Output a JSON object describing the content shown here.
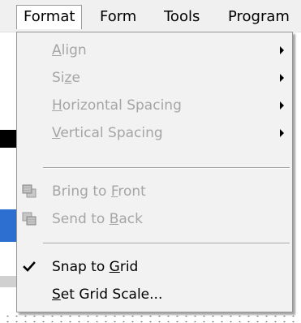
{
  "menubar": {
    "items": [
      {
        "label": "Format",
        "active": true
      },
      {
        "label": "Form"
      },
      {
        "label": "Tools"
      },
      {
        "label": "Program"
      }
    ]
  },
  "format_menu": {
    "items": [
      {
        "pre": "",
        "key": "A",
        "post": "lign",
        "enabled": false,
        "submenu": true,
        "icon": ""
      },
      {
        "pre": "Si",
        "key": "z",
        "post": "e",
        "enabled": false,
        "submenu": true,
        "icon": ""
      },
      {
        "pre": "",
        "key": "H",
        "post": "orizontal Spacing",
        "enabled": false,
        "submenu": true,
        "icon": ""
      },
      {
        "pre": "",
        "key": "V",
        "post": "ertical Spacing",
        "enabled": false,
        "submenu": true,
        "icon": ""
      },
      {
        "pre": "Bring to ",
        "key": "F",
        "post": "ront",
        "enabled": false,
        "submenu": false,
        "icon": "bring-to-front-icon"
      },
      {
        "pre": "Send to ",
        "key": "B",
        "post": "ack",
        "enabled": false,
        "submenu": false,
        "icon": "send-to-back-icon"
      },
      {
        "pre": "Snap to ",
        "key": "G",
        "post": "rid",
        "enabled": true,
        "submenu": false,
        "icon": "checkmark-icon",
        "checked": true
      },
      {
        "pre": "",
        "key": "S",
        "post": "et Grid Scale...",
        "enabled": true,
        "submenu": false,
        "icon": ""
      }
    ]
  },
  "colors": {
    "menu_bg": "#f2f2f2",
    "disabled_text": "#a5a5a5",
    "enabled_text": "#000000"
  }
}
